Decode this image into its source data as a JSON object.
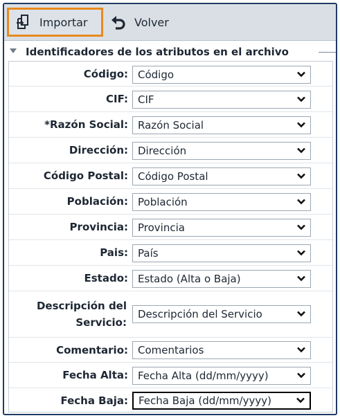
{
  "toolbar": {
    "import_label": "Importar",
    "back_label": "Volver"
  },
  "section": {
    "title": "Identificadores de los atributos en el archivo"
  },
  "fields": [
    {
      "label": "Código:",
      "value": "Código"
    },
    {
      "label": "CIF:",
      "value": "CIF"
    },
    {
      "label": "*Razón Social:",
      "value": "Razón Social"
    },
    {
      "label": "Dirección:",
      "value": "Dirección"
    },
    {
      "label": "Código Postal:",
      "value": "Código Postal"
    },
    {
      "label": "Población:",
      "value": "Población"
    },
    {
      "label": "Provincia:",
      "value": "Provincia"
    },
    {
      "label": "Pais:",
      "value": "País"
    },
    {
      "label": "Estado:",
      "value": "Estado (Alta o Baja)"
    },
    {
      "label": "Descripción del Servicio:",
      "value": "Descripción del Servicio"
    },
    {
      "label": "Comentario:",
      "value": "Comentarios"
    },
    {
      "label": "Fecha Alta:",
      "value": "Fecha Alta (dd/mm/yyyy)"
    },
    {
      "label": "Fecha Baja:",
      "value": "Fecha Baja (dd/mm/yyyy)"
    }
  ],
  "colors": {
    "highlight": "#e8891d",
    "toolbar_bg": "#d9dfe5",
    "frame_border": "#1f3b63"
  },
  "icons": {
    "import": "import-icon",
    "back": "undo-arrow-icon",
    "collapse": "caret-down-icon",
    "dropdown": "chevron-down-icon"
  }
}
